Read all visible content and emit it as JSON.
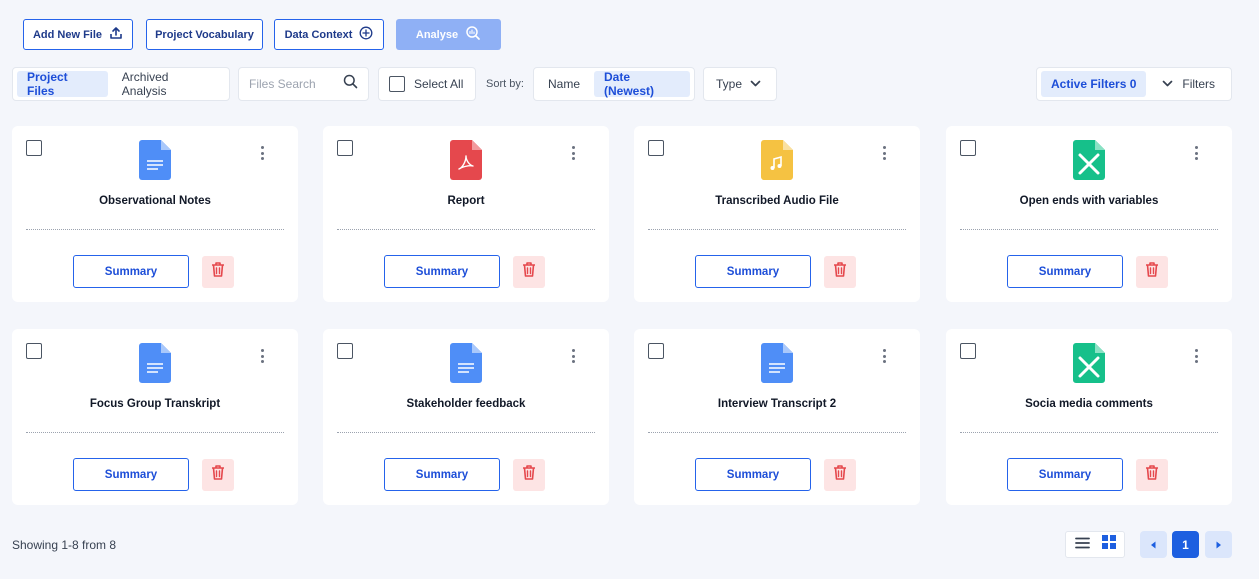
{
  "toolbar": {
    "add_file": "Add New File",
    "vocabulary": "Project Vocabulary",
    "data_context": "Data Context",
    "analyse": "Analyse"
  },
  "tabs": {
    "project_files": "Project Files",
    "archived": "Archived Analysis"
  },
  "search": {
    "placeholder": "Files Search"
  },
  "select_all": "Select All",
  "sort": {
    "label": "Sort by:",
    "name": "Name",
    "date": "Date (Newest)"
  },
  "type_filter": "Type",
  "filters": {
    "active": "Active Filters 0",
    "label": "Filters"
  },
  "cards": [
    {
      "name": "Observational Notes",
      "icon": "doc-icon",
      "summary": "Summary"
    },
    {
      "name": "Report",
      "icon": "pdf-icon",
      "summary": "Summary"
    },
    {
      "name": "Transcribed Audio File",
      "icon": "audio-icon",
      "summary": "Summary"
    },
    {
      "name": "Open ends with variables",
      "icon": "spreadsheet-icon",
      "summary": "Summary"
    },
    {
      "name": "Focus Group Transkript",
      "icon": "doc-icon",
      "summary": "Summary"
    },
    {
      "name": "Stakeholder feedback",
      "icon": "doc-icon",
      "summary": "Summary"
    },
    {
      "name": "Interview Transcript 2",
      "icon": "doc-icon",
      "summary": "Summary"
    },
    {
      "name": "Socia media comments",
      "icon": "spreadsheet-icon",
      "summary": "Summary"
    }
  ],
  "footer": {
    "showing": "Showing 1-8 from 8"
  },
  "pagination": {
    "current": "1"
  },
  "colors": {
    "primary": "#2563eb",
    "doc": "#4f8ef7",
    "pdf": "#e5484d",
    "audio": "#f5c242",
    "sheet": "#16c08a",
    "trash": "#e5484d"
  }
}
